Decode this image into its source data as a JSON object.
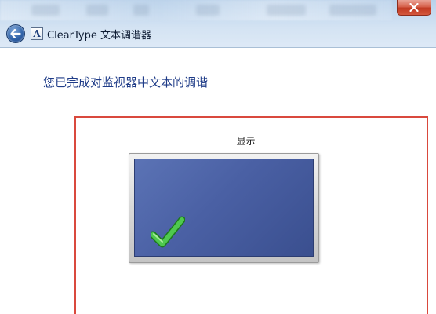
{
  "window": {
    "title": "ClearType 文本调谐器",
    "app_icon_glyph": "A",
    "close_icon": "close-icon",
    "back_icon": "back-arrow-icon"
  },
  "main": {
    "heading": "您已完成对监视器中文本的调谐",
    "display_label": "显示",
    "status_icon": "checkmark-icon"
  },
  "colors": {
    "heading_text": "#1f3c88",
    "frame_border": "#d9493d",
    "screen_blue": "#4a60a4",
    "check_green": "#2fae2f",
    "close_red": "#c13a22"
  }
}
